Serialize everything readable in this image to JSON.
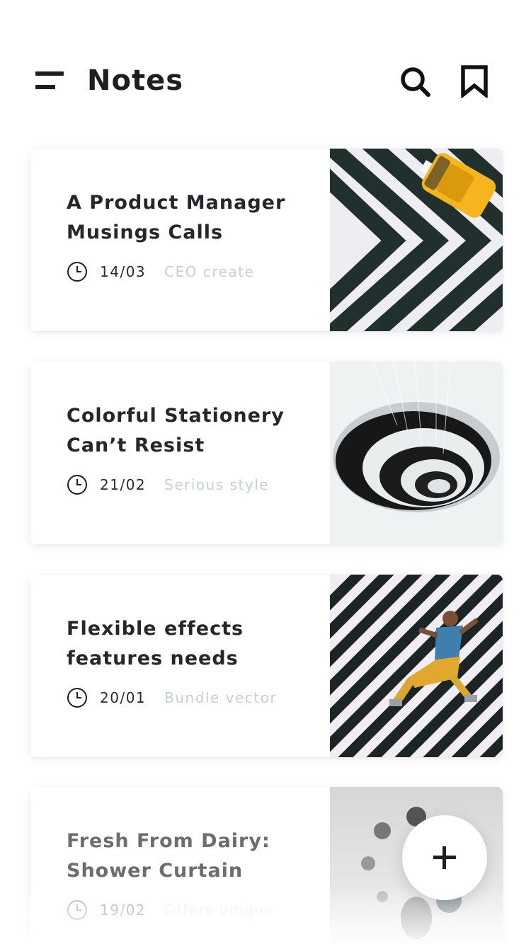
{
  "header": {
    "title": "Notes",
    "menu_icon": "menu-icon",
    "search_icon": "search-icon",
    "bookmark_icon": "bookmark-icon"
  },
  "notes": [
    {
      "title_line1": "A Product Manager",
      "title_line2": "Musings Calls",
      "date": "14/03",
      "tag": "CEO create",
      "image": "crosswalk-taxi"
    },
    {
      "title_line1": "Colorful Stationery",
      "title_line2": "Can’t Resist",
      "date": "21/02",
      "tag": "Serious style",
      "image": "spiral-staircase"
    },
    {
      "title_line1": "Flexible effects",
      "title_line2": "features needs",
      "date": "20/01",
      "tag": "Bundle vector",
      "image": "crosswalk-runner"
    },
    {
      "title_line1": "Fresh From Dairy:",
      "title_line2": "Shower Curtain",
      "date": "19/02",
      "tag": "Offers unique",
      "image": "grey-dots"
    }
  ],
  "fab": {
    "icon": "plus-icon"
  },
  "colors": {
    "text": "#1e1f24",
    "tag": "#c8cfd4",
    "taxi": "#f5b51f",
    "background": "#ffffff"
  }
}
